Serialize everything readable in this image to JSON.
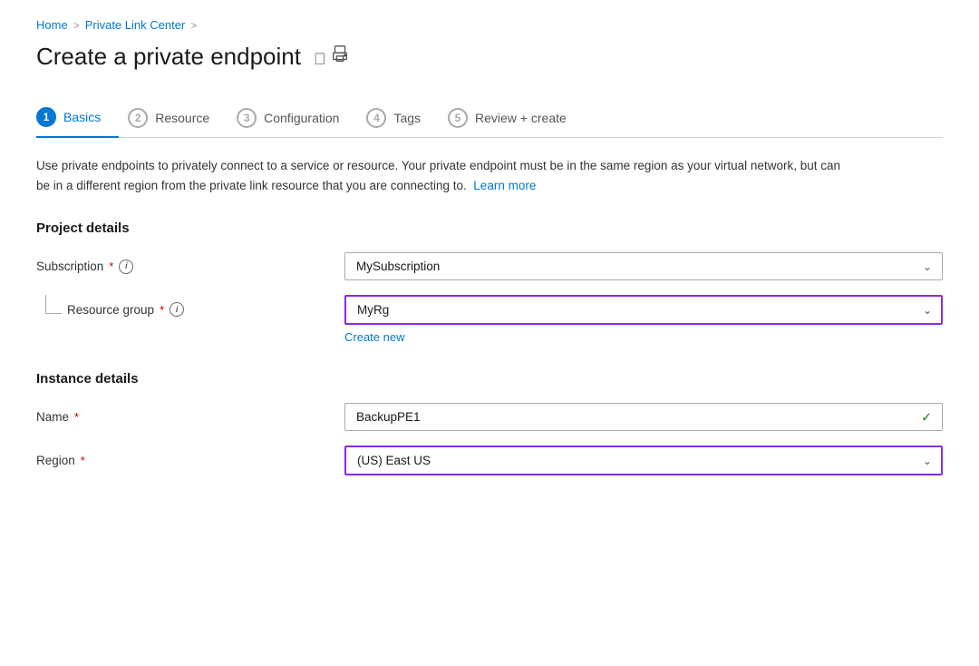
{
  "breadcrumb": {
    "home": "Home",
    "separator1": ">",
    "privateLink": "Private Link Center",
    "separator2": ">"
  },
  "pageTitle": "Create a private endpoint",
  "tabs": [
    {
      "num": "1",
      "label": "Basics",
      "active": true
    },
    {
      "num": "2",
      "label": "Resource",
      "active": false
    },
    {
      "num": "3",
      "label": "Configuration",
      "active": false
    },
    {
      "num": "4",
      "label": "Tags",
      "active": false
    },
    {
      "num": "5",
      "label": "Review + create",
      "active": false
    }
  ],
  "description": {
    "text": "Use private endpoints to privately connect to a service or resource. Your private endpoint must be in the same region as your virtual network, but can be in a different region from the private link resource that you are connecting to.",
    "linkText": "Learn more"
  },
  "projectDetails": {
    "sectionTitle": "Project details",
    "subscription": {
      "label": "Subscription",
      "value": "MySubscription"
    },
    "resourceGroup": {
      "label": "Resource group",
      "value": "MyRg",
      "createNewLabel": "Create new"
    }
  },
  "instanceDetails": {
    "sectionTitle": "Instance details",
    "name": {
      "label": "Name",
      "value": "BackupPE1"
    },
    "region": {
      "label": "Region",
      "value": "(US) East US"
    }
  }
}
